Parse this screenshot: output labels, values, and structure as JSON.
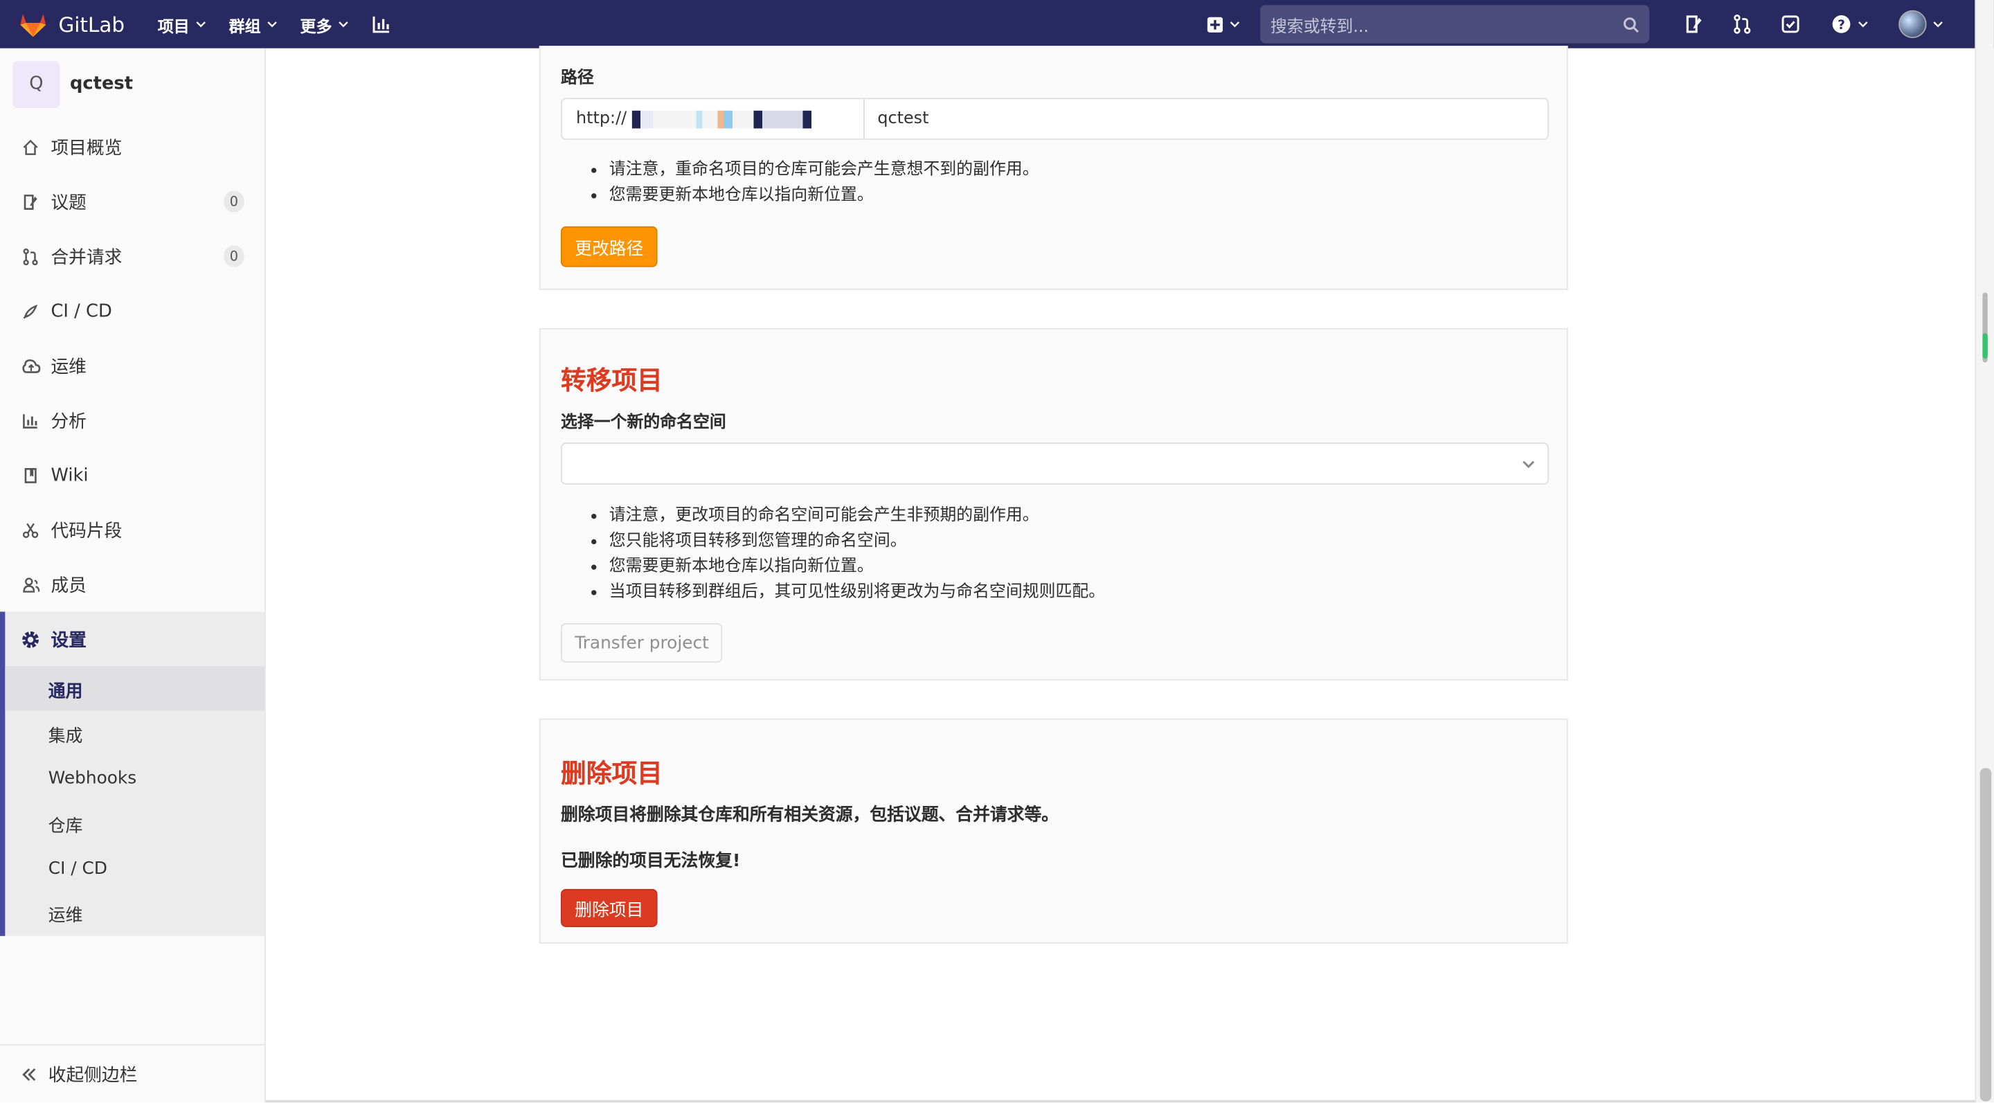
{
  "navbar": {
    "brand": "GitLab",
    "menu": [
      {
        "label": "项目"
      },
      {
        "label": "群组"
      },
      {
        "label": "更多"
      }
    ],
    "search_placeholder": "搜索或转到..."
  },
  "sidebar": {
    "project_initial": "Q",
    "project_name": "qctest",
    "items": [
      {
        "label": "项目概览",
        "icon": "home-icon"
      },
      {
        "label": "议题",
        "icon": "issues-icon",
        "badge": "0"
      },
      {
        "label": "合并请求",
        "icon": "merge-request-icon",
        "badge": "0"
      },
      {
        "label": "CI / CD",
        "icon": "rocket-icon"
      },
      {
        "label": "运维",
        "icon": "cloud-icon"
      },
      {
        "label": "分析",
        "icon": "chart-icon"
      },
      {
        "label": "Wiki",
        "icon": "book-icon"
      },
      {
        "label": "代码片段",
        "icon": "scissors-icon"
      },
      {
        "label": "成员",
        "icon": "users-icon"
      }
    ],
    "settings_label": "设置",
    "settings_sub": [
      "通用",
      "集成",
      "Webhooks",
      "仓库",
      "CI / CD",
      "运维"
    ],
    "collapse_label": "收起侧边栏"
  },
  "path_section": {
    "label": "路径",
    "prefix": "http://",
    "value": "qctest",
    "notes": [
      "请注意，重命名项目的仓库可能会产生意想不到的副作用。",
      "您需要更新本地仓库以指向新位置。"
    ],
    "button": "更改路径"
  },
  "transfer_section": {
    "title": "转移项目",
    "label": "选择一个新的命名空间",
    "notes": [
      "请注意，更改项目的命名空间可能会产生非预期的副作用。",
      "您只能将项目转移到您管理的命名空间。",
      "您需要更新本地仓库以指向新位置。",
      "当项目转移到群组后，其可见性级别将更改为与命名空间规则匹配。"
    ],
    "button": "Transfer project"
  },
  "delete_section": {
    "title": "删除项目",
    "description": "删除项目将删除其仓库和所有相关资源，包括议题、合并请求等。",
    "warning": "已删除的项目无法恢复!",
    "button": "删除项目"
  },
  "colors": {
    "navbar": "#292961",
    "danger": "#db3b21",
    "warning": "#fc9403"
  }
}
